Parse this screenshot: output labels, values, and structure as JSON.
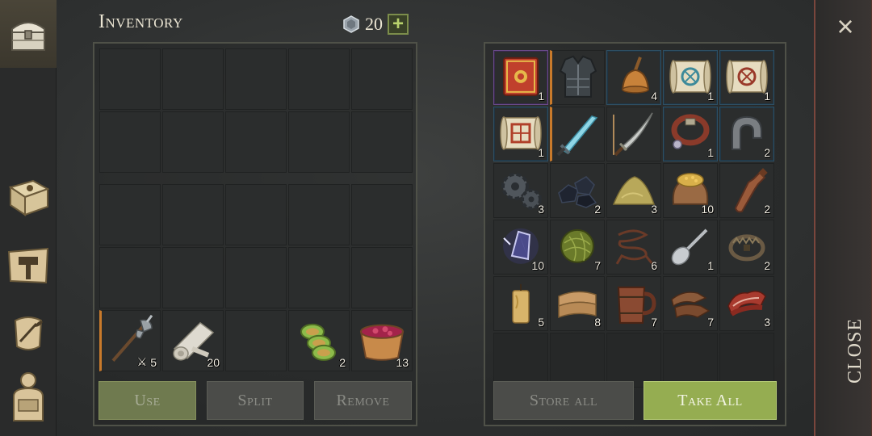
{
  "inventory": {
    "title": "Inventory",
    "gem_count": "20",
    "plus_label": "+",
    "hotbar": [
      {
        "name": "halberd",
        "qty": "5",
        "qty_prefix": "⚔"
      },
      {
        "name": "cloth-roll",
        "qty": "20"
      },
      {
        "name": "empty",
        "qty": ""
      },
      {
        "name": "cactus-slices",
        "qty": "2"
      },
      {
        "name": "berry-bowl",
        "qty": "13"
      }
    ],
    "buttons": {
      "use": "Use",
      "split": "Split",
      "remove": "Remove"
    }
  },
  "chest": {
    "items": [
      {
        "name": "spell-book",
        "qty": "1"
      },
      {
        "name": "armor-vest",
        "qty": ""
      },
      {
        "name": "bronze-bell",
        "qty": "4"
      },
      {
        "name": "scroll-blue",
        "qty": "1"
      },
      {
        "name": "scroll-red-1",
        "qty": "1"
      },
      {
        "name": "scroll-red-2",
        "qty": "1"
      },
      {
        "name": "ice-sword",
        "qty": ""
      },
      {
        "name": "katana",
        "qty": ""
      },
      {
        "name": "leather-collar",
        "qty": "1"
      },
      {
        "name": "iron-horseshoe",
        "qty": "2"
      },
      {
        "name": "gears",
        "qty": "3"
      },
      {
        "name": "coal",
        "qty": "2"
      },
      {
        "name": "sand-pile",
        "qty": "3"
      },
      {
        "name": "grain-sack",
        "qty": "10"
      },
      {
        "name": "bottle",
        "qty": "2"
      },
      {
        "name": "crystal",
        "qty": "10"
      },
      {
        "name": "fiber-ball",
        "qty": "7"
      },
      {
        "name": "rope",
        "qty": "6"
      },
      {
        "name": "spoon",
        "qty": "1"
      },
      {
        "name": "bear-trap",
        "qty": "2"
      },
      {
        "name": "candle",
        "qty": "5"
      },
      {
        "name": "folded-cloth",
        "qty": "8"
      },
      {
        "name": "wooden-mug",
        "qty": "7"
      },
      {
        "name": "leather-strips",
        "qty": "7"
      },
      {
        "name": "bacon",
        "qty": "3"
      }
    ],
    "buttons": {
      "store_all": "Store all",
      "take_all": "Take All"
    }
  },
  "close": {
    "icon": "×",
    "label": "CLOSE"
  },
  "colors": {
    "accent_green": "#95ad51",
    "rarity_orange": "#c97a2b",
    "rarity_purple": "#6a4a8a",
    "rarity_blue": "#2e4f63"
  }
}
